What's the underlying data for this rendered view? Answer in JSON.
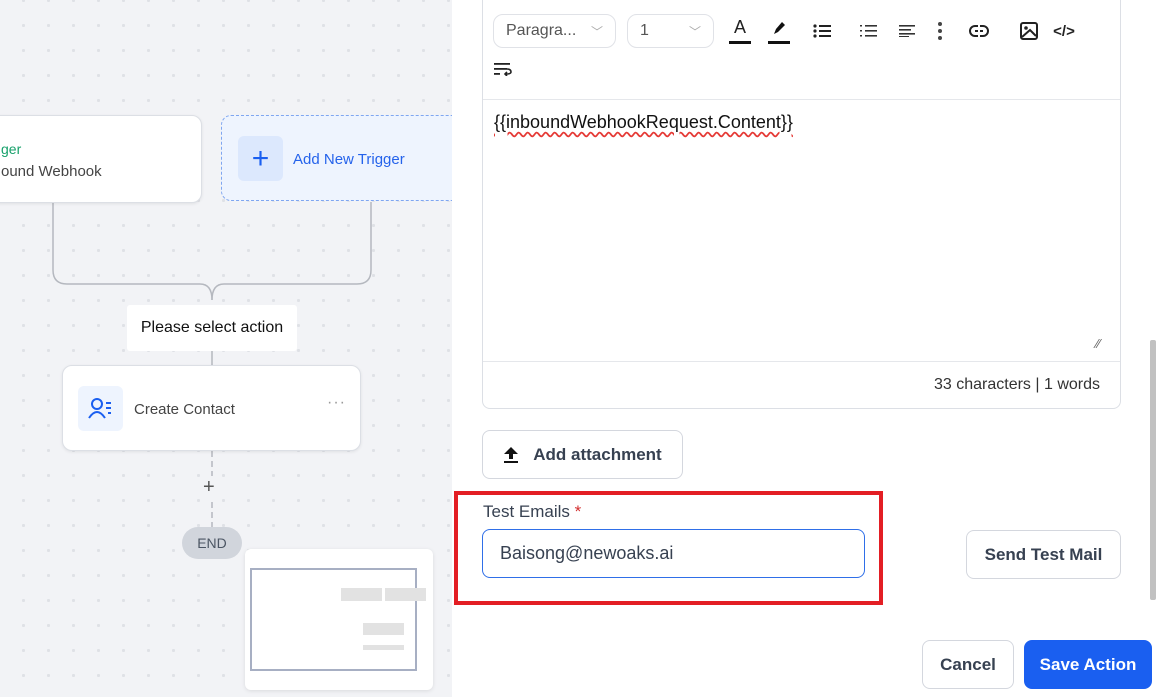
{
  "canvas": {
    "trigger_card": {
      "title": "ger",
      "subtitle": "ound Webhook"
    },
    "add_trigger": {
      "label": "Add New Trigger",
      "icon": "plus-icon"
    },
    "select_action_label": "Please select action",
    "action_card": {
      "label": "Create Contact",
      "icon": "contact-list-icon",
      "menu_icon": "more-horizontal-icon"
    },
    "add_step_icon": "plus-icon",
    "end_label": "END"
  },
  "editor": {
    "format_select": "Paragra...",
    "size_select": "1",
    "toolbar_icons": [
      "text-color-icon",
      "highlight-icon",
      "bullet-list-icon",
      "numbered-list-icon",
      "align-left-icon",
      "more-vertical-icon",
      "link-icon",
      "image-icon",
      "code-icon",
      "wrap-text-icon"
    ],
    "content": "{{inboundWebhookRequest.Content}}",
    "counter": "33 characters | 1 words"
  },
  "attachment_button": "Add attachment",
  "test_emails": {
    "label": "Test Emails",
    "required_mark": "*",
    "value": "Baisong@newoaks.ai"
  },
  "send_test_button": "Send Test Mail",
  "cancel_button": "Cancel",
  "save_button": "Save Action",
  "colors": {
    "primary": "#1a5ff0",
    "highlight_box": "#e31e24",
    "trigger_green": "#16a06a"
  }
}
